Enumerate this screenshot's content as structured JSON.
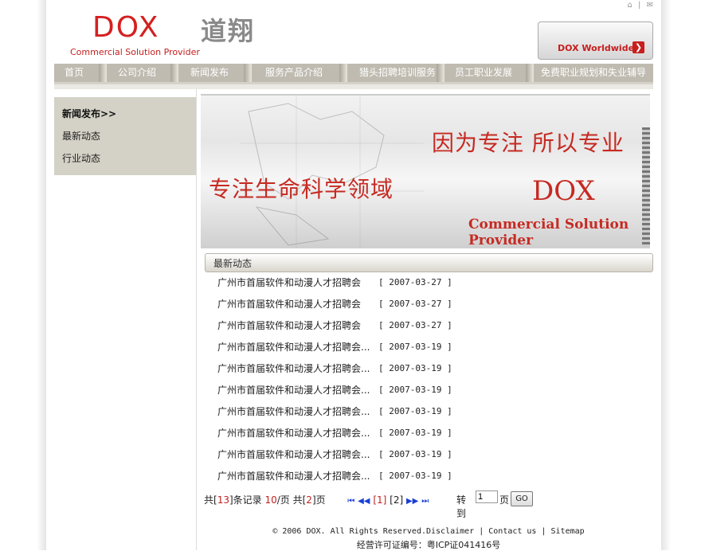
{
  "header": {
    "logo_text": "DOX",
    "logo_cn": "道翔",
    "logo_subtitle": "Commercial Solution Provider",
    "worldwide_label": "DOX Worldwide",
    "top_icons": [
      "home-icon",
      "mail-icon"
    ]
  },
  "nav": {
    "items": [
      {
        "label": "首页"
      },
      {
        "label": "公司介绍"
      },
      {
        "label": "新闻发布"
      },
      {
        "label": "服务产品介绍"
      },
      {
        "label": "猎头招聘培训服务"
      },
      {
        "label": "员工职业发展"
      },
      {
        "label": "免费职业规划和失业辅导"
      }
    ]
  },
  "sidebar": {
    "heading": "新闻发布>>",
    "items": [
      {
        "label": "最新动态"
      },
      {
        "label": "行业动态"
      }
    ]
  },
  "banner": {
    "slogan": "因为专注 所以专业",
    "focus": "专注生命科学领域",
    "brand": "DOX",
    "tagline": "Commercial Solution Provider"
  },
  "section": {
    "title": "最新动态"
  },
  "news": [
    {
      "title": "广州市首届软件和动漫人才招聘会",
      "date": "[ 2007-03-27 ]"
    },
    {
      "title": "广州市首届软件和动漫人才招聘会",
      "date": "[ 2007-03-27 ]"
    },
    {
      "title": "广州市首届软件和动漫人才招聘会",
      "date": "[ 2007-03-27 ]"
    },
    {
      "title": "广州市首届软件和动漫人才招聘会...",
      "date": "[ 2007-03-19 ]"
    },
    {
      "title": "广州市首届软件和动漫人才招聘会...",
      "date": "[ 2007-03-19 ]"
    },
    {
      "title": "广州市首届软件和动漫人才招聘会...",
      "date": "[ 2007-03-19 ]"
    },
    {
      "title": "广州市首届软件和动漫人才招聘会...",
      "date": "[ 2007-03-19 ]"
    },
    {
      "title": "广州市首届软件和动漫人才招聘会...",
      "date": "[ 2007-03-19 ]"
    },
    {
      "title": "广州市首届软件和动漫人才招聘会...",
      "date": "[ 2007-03-19 ]"
    },
    {
      "title": "广州市首届软件和动漫人才招聘会...",
      "date": "[ 2007-03-19 ]"
    }
  ],
  "pager": {
    "total_prefix": "共[",
    "total_records": "13",
    "total_mid": "]条记录 ",
    "per_page": "10",
    "per_page_suffix": "/页 共[",
    "total_pages": "2",
    "pages_suffix": "]页",
    "page1": "[1]",
    "page2": "[2]",
    "goto_label": "转到",
    "goto_value": "1",
    "page_unit": "页",
    "go_label": "GO"
  },
  "footer": {
    "copyright": "© 2006 DOX. All Rights Reserved.Disclaimer | Contact us | Sitemap",
    "license": "经营许可证编号：粤ICP证041416号"
  }
}
